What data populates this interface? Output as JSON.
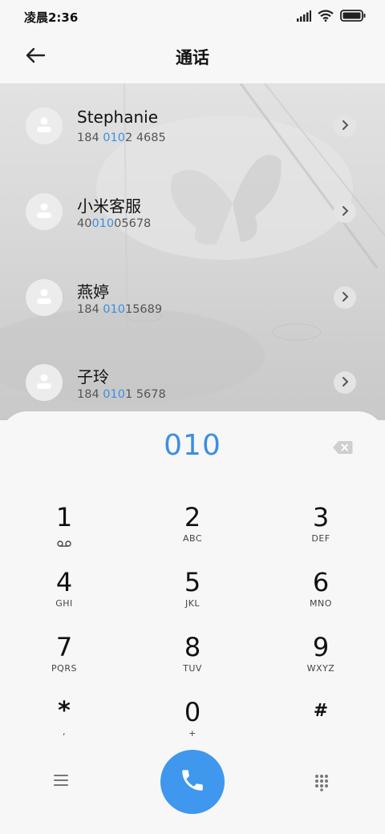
{
  "status_bar": {
    "time": "凌晨2:36",
    "icons": [
      "signal-icon",
      "wifi-icon",
      "battery-icon"
    ]
  },
  "header": {
    "title": "通话",
    "back_icon": "back-arrow-icon"
  },
  "contacts": [
    {
      "name": "Stephanie",
      "number_pre": "184 ",
      "number_match": "010",
      "number_post": "2 4685"
    },
    {
      "name": "小米客服",
      "number_pre": "40",
      "number_match": "010",
      "number_post": "05678"
    },
    {
      "name": "燕婷",
      "number_pre": "184 ",
      "number_match": "010",
      "number_post": "15689"
    },
    {
      "name": "子玲",
      "number_pre": "184 ",
      "number_match": "010",
      "number_post": "1 5678"
    }
  ],
  "dialpad": {
    "input": "010",
    "keys": [
      {
        "digit": "1",
        "sub": ""
      },
      {
        "digit": "2",
        "sub": "ABC"
      },
      {
        "digit": "3",
        "sub": "DEF"
      },
      {
        "digit": "4",
        "sub": "GHI"
      },
      {
        "digit": "5",
        "sub": "JKL"
      },
      {
        "digit": "6",
        "sub": "MNO"
      },
      {
        "digit": "7",
        "sub": "PQRS"
      },
      {
        "digit": "8",
        "sub": "TUV"
      },
      {
        "digit": "9",
        "sub": "WXYZ"
      },
      {
        "digit": "*",
        "sub": ","
      },
      {
        "digit": "0",
        "sub": "+"
      },
      {
        "digit": "#",
        "sub": ""
      }
    ]
  },
  "bottom_bar": {
    "menu_icon": "menu-icon",
    "call_icon": "phone-icon",
    "keypad_icon": "dialpad-grid-icon"
  },
  "colors": {
    "accent": "#3c8fe0",
    "call_button": "#3f97ee",
    "background": "#f7f7f7"
  }
}
